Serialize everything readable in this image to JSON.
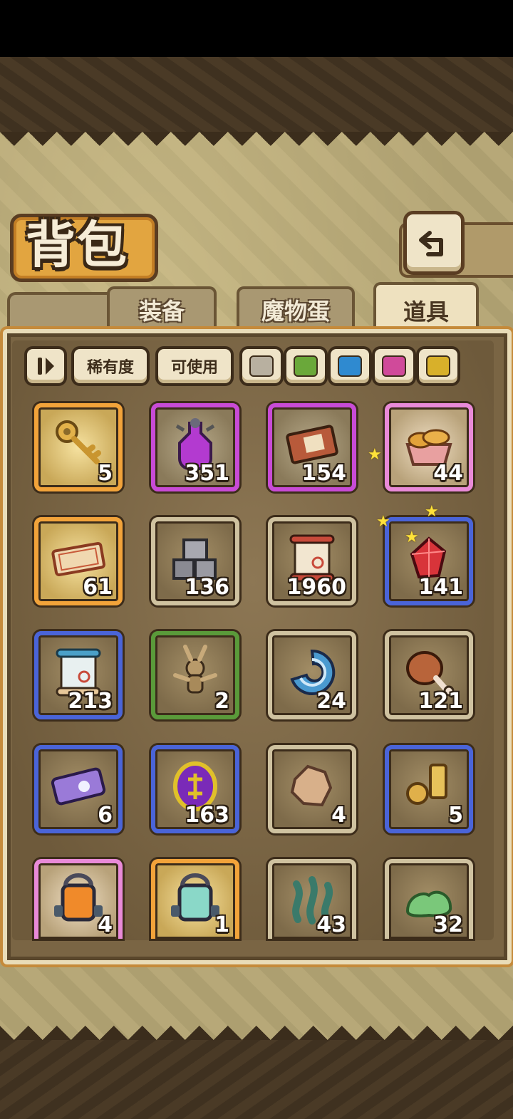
{
  "header": {
    "title": "背包"
  },
  "tabs": [
    {
      "label": "装备",
      "active": false
    },
    {
      "label": "魔物蛋",
      "active": false
    },
    {
      "label": "道具",
      "active": true
    }
  ],
  "filters": {
    "sort_icon": "sort-toggle-icon",
    "rarity_label": "稀有度",
    "usable_label": "可使用",
    "rarity_colors": [
      {
        "name": "grey",
        "color": "#b8b0a0"
      },
      {
        "name": "green",
        "color": "#6aa83a"
      },
      {
        "name": "blue",
        "color": "#2f8ad0"
      },
      {
        "name": "pink",
        "color": "#d04a9a"
      },
      {
        "name": "gold",
        "color": "#d8b02a"
      }
    ]
  },
  "items": [
    {
      "icon": "golden-key-icon",
      "rarity": "orange",
      "count": "5"
    },
    {
      "icon": "purple-potion-icon",
      "rarity": "purple",
      "count": "351"
    },
    {
      "icon": "ticket-card-icon",
      "rarity": "purple",
      "count": "154"
    },
    {
      "icon": "bread-basket-icon",
      "rarity": "pink",
      "count": "44"
    },
    {
      "icon": "coupon-ticket-icon",
      "rarity": "orange",
      "count": "61"
    },
    {
      "icon": "stone-blocks-icon",
      "rarity": "grey",
      "count": "136"
    },
    {
      "icon": "red-scroll-icon",
      "rarity": "grey",
      "count": "1960"
    },
    {
      "icon": "red-crystal-icon",
      "rarity": "blue",
      "count": "141"
    },
    {
      "icon": "blue-scroll-icon",
      "rarity": "blue",
      "count": "213"
    },
    {
      "icon": "voodoo-doll-icon",
      "rarity": "green",
      "count": "2"
    },
    {
      "icon": "blue-shell-icon",
      "rarity": "grey",
      "count": "24"
    },
    {
      "icon": "chicken-leg-icon",
      "rarity": "grey",
      "count": "121"
    },
    {
      "icon": "purple-ticket-icon",
      "rarity": "blue",
      "count": "6"
    },
    {
      "icon": "purple-coin-icon",
      "rarity": "blue",
      "count": "163"
    },
    {
      "icon": "ore-chunk-icon",
      "rarity": "grey",
      "count": "4"
    },
    {
      "icon": "gold-relic-icon",
      "rarity": "blue",
      "count": "5"
    },
    {
      "icon": "orange-lantern-icon",
      "rarity": "pink",
      "count": "4"
    },
    {
      "icon": "rainbow-lantern-icon",
      "rarity": "orange",
      "count": "1"
    },
    {
      "icon": "seaweed-icon",
      "rarity": "grey",
      "count": "43"
    },
    {
      "icon": "green-slime-icon",
      "rarity": "grey",
      "count": "32"
    }
  ]
}
